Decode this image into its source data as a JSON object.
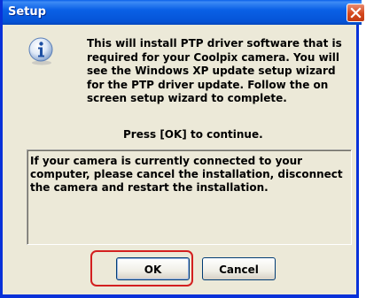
{
  "window": {
    "title": "Setup"
  },
  "dialog": {
    "icon": "information-icon",
    "message": "This will install PTP driver software that is required for your Coolpix camera. You will see the Windows XP update setup wizard for the PTP driver update. Follow the on screen setup wizard to complete.",
    "press_text": "Press [OK] to continue.",
    "note": "If your camera is currently connected to your computer, please cancel the installation, disconnect the camera and restart the installation."
  },
  "buttons": {
    "ok_label": "OK",
    "cancel_label": "Cancel"
  },
  "colors": {
    "title_bar": "#0a5fe8",
    "highlight_ring": "#d32020"
  }
}
